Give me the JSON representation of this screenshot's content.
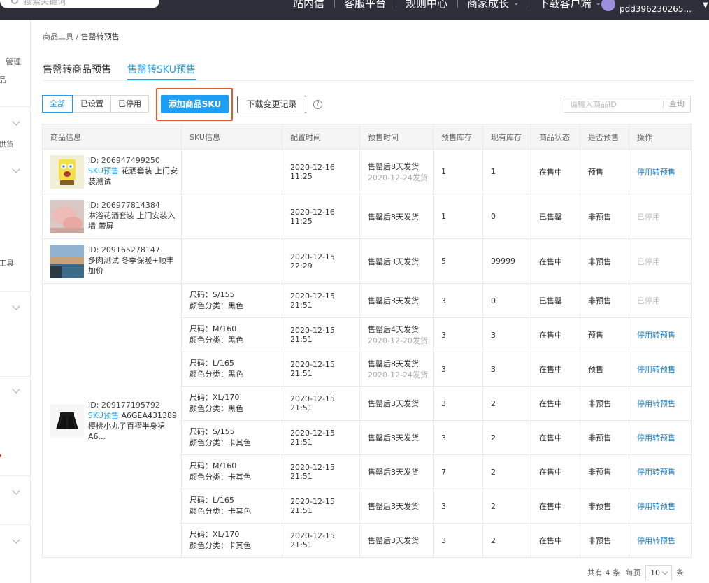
{
  "topbar": {
    "search_placeholder": "搜索关键词",
    "nav": [
      "站内信",
      "客服平台",
      "规则中心",
      "商家成长",
      "下载客户端"
    ],
    "username": "pdd396230265..."
  },
  "sidebar": {
    "labels": [
      "管理",
      "品",
      "供货",
      "工具"
    ]
  },
  "breadcrumb": {
    "parent": "商品工具",
    "sep": " / ",
    "current": "售罄转预售"
  },
  "tabs": [
    "售罄转商品预售",
    "售罄转SKU预售"
  ],
  "filters": [
    "全部",
    "已设置",
    "已停用"
  ],
  "actions": {
    "add": "添加商品SKU",
    "download": "下载变更记录",
    "help": "?"
  },
  "id_search": {
    "placeholder": "请输入商品ID",
    "button": "查询"
  },
  "table": {
    "headers": [
      "商品信息",
      "SKU信息",
      "配置时间",
      "预售时间",
      "预售库存",
      "现有库存",
      "商品状态",
      "是否预售",
      "操作"
    ],
    "products": [
      {
        "id": "ID: 206947499250",
        "tag": "SKU预售",
        "name": "花洒套装 上门安装测试",
        "time": "2020-12-16 11:25",
        "presale": "售罄后8天发货",
        "presale_sub": "2020-12-24发货",
        "presale_stock": "1",
        "stock": "1",
        "status": "在售中",
        "is_presale": "预售",
        "op": "停用转预售",
        "op_disabled": false
      },
      {
        "id": "ID: 206977814384",
        "tag": "",
        "name": "淋浴花洒套装 上门安装入墙 带屏",
        "time": "2020-12-16 11:25",
        "presale": "售罄后8天发货",
        "presale_sub": "",
        "presale_stock": "1",
        "stock": "0",
        "status": "已售罄",
        "is_presale": "非预售",
        "op": "已停用",
        "op_disabled": true
      },
      {
        "id": "ID: 209165278147",
        "tag": "",
        "name": "多肉测试 冬季保暖+顺丰加价",
        "time": "2020-12-15 22:29",
        "presale": "售罄后3天发货",
        "presale_sub": "",
        "presale_stock": "5",
        "stock": "99999",
        "status": "在售中",
        "is_presale": "非预售",
        "op": "已停用",
        "op_disabled": true
      }
    ],
    "sku_product": {
      "id": "ID: 209177195792",
      "tag": "SKU预售",
      "name": "A6GEA431389樱桃小丸子百褶半身裙A6..."
    },
    "sku_rows": [
      {
        "size": "尺码：S/155",
        "color": "颜色分类：黑色",
        "time": "2020-12-15 21:51",
        "presale": "售罄后3天发货",
        "presale_sub": "",
        "presale_stock": "3",
        "stock": "0",
        "status": "已售罄",
        "is_presale": "非预售",
        "op": "已停用",
        "op_disabled": true
      },
      {
        "size": "尺码：M/160",
        "color": "颜色分类：黑色",
        "time": "2020-12-15 21:51",
        "presale": "售罄后4天发货",
        "presale_sub": "2020-12-20发货",
        "presale_stock": "3",
        "stock": "3",
        "status": "在售中",
        "is_presale": "预售",
        "op": "停用转预售",
        "op_disabled": false
      },
      {
        "size": "尺码：L/165",
        "color": "颜色分类：黑色",
        "time": "2020-12-15 21:51",
        "presale": "售罄后8天发货",
        "presale_sub": "2020-12-24发货",
        "presale_stock": "3",
        "stock": "3",
        "status": "在售中",
        "is_presale": "预售",
        "op": "停用转预售",
        "op_disabled": false
      },
      {
        "size": "尺码：XL/170",
        "color": "颜色分类：黑色",
        "time": "2020-12-15 21:51",
        "presale": "售罄后3天发货",
        "presale_sub": "",
        "presale_stock": "3",
        "stock": "2",
        "status": "在售中",
        "is_presale": "非预售",
        "op": "停用转预售",
        "op_disabled": false
      },
      {
        "size": "尺码：S/155",
        "color": "颜色分类：卡其色",
        "time": "2020-12-15 21:51",
        "presale": "售罄后3天发货",
        "presale_sub": "",
        "presale_stock": "3",
        "stock": "2",
        "status": "在售中",
        "is_presale": "非预售",
        "op": "停用转预售",
        "op_disabled": false
      },
      {
        "size": "尺码：M/160",
        "color": "颜色分类：卡其色",
        "time": "2020-12-15 21:51",
        "presale": "售罄后3天发货",
        "presale_sub": "",
        "presale_stock": "7",
        "stock": "2",
        "status": "在售中",
        "is_presale": "非预售",
        "op": "停用转预售",
        "op_disabled": false
      },
      {
        "size": "尺码：L/165",
        "color": "颜色分类：卡其色",
        "time": "2020-12-15 21:51",
        "presale": "售罄后3天发货",
        "presale_sub": "",
        "presale_stock": "3",
        "stock": "2",
        "status": "在售中",
        "is_presale": "非预售",
        "op": "停用转预售",
        "op_disabled": false
      },
      {
        "size": "尺码：XL/170",
        "color": "颜色分类：卡其色",
        "time": "2020-12-15 21:51",
        "presale": "售罄后3天发货",
        "presale_sub": "",
        "presale_stock": "3",
        "stock": "2",
        "status": "在售中",
        "is_presale": "非预售",
        "op": "停用转预售",
        "op_disabled": false
      }
    ]
  },
  "pagination": {
    "total": "共有 4 条",
    "per_page_label": "每页",
    "per_page": "10",
    "unit": "条"
  },
  "colors": {
    "accent": "#1d9ff5",
    "highlight": "#e35a2a",
    "topbar": "#2e2f3a"
  }
}
